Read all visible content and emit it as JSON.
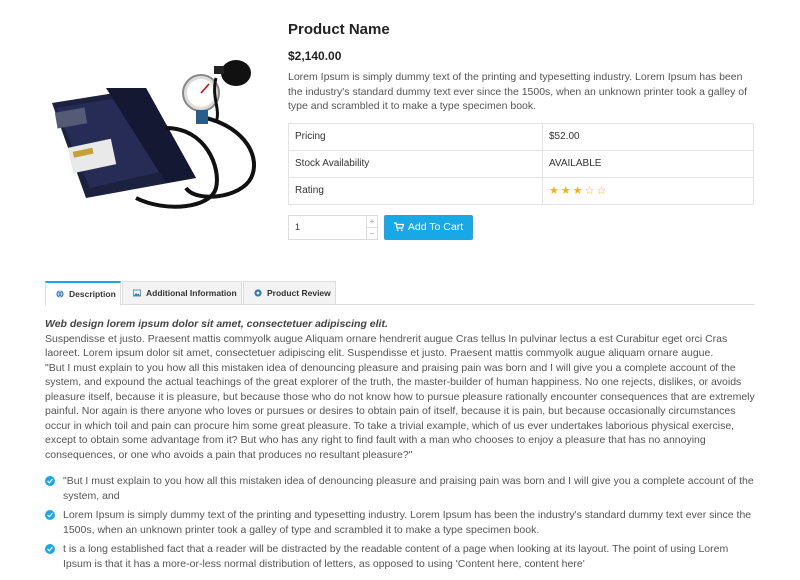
{
  "product": {
    "name": "Product Name",
    "price": "$2,140.00",
    "description": "Lorem Ipsum is simply dummy text of the printing and typesetting industry. Lorem Ipsum has been the industry's standard dummy text ever since the 1500s, when an unknown printer took a galley of type and scrambled it to make a type specimen book.",
    "image_icon": "blood-pressure-monitor"
  },
  "specs": [
    {
      "label": "Pricing",
      "value": "$52.00"
    },
    {
      "label": "Stock Availability",
      "value": "AVAILABLE"
    },
    {
      "label": "Rating",
      "rating": 3,
      "max": 5
    }
  ],
  "cart": {
    "quantity": "1",
    "add_label": "Add To Cart",
    "accent": "#19a8e6"
  },
  "tabs": [
    {
      "label": "Description",
      "icon": "globe-icon",
      "active": true
    },
    {
      "label": "Additional Information",
      "icon": "image-icon",
      "active": false
    },
    {
      "label": "Product Review",
      "icon": "circle-icon",
      "active": false
    }
  ],
  "content": {
    "lead": "Web design lorem ipsum dolor sit amet, consectetuer adipiscing elit.",
    "intro": "Suspendisse et justo. Praesent mattis commyolk augue Aliquam ornare hendrerit augue Cras tellus In pulvinar lectus a est Curabitur eget orci Cras laoreet. Lorem ipsum dolor sit amet, consectetuer adipiscing elit. Suspendisse et justo. Praesent mattis commyolk augue aliquam ornare augue.",
    "quote": "\"But I must explain to you how all this mistaken idea of denouncing pleasure and praising pain was born and I will give you a complete account of the system, and expound the actual teachings of the great explorer of the truth, the master-builder of human happiness. No one rejects, dislikes, or avoids pleasure itself, because it is pleasure, but because those who do not know how to pursue pleasure rationally encounter consequences that are extremely painful. Nor again is there anyone who loves or pursues or desires to obtain pain of itself, because it is pain, but because occasionally circumstances occur in which toil and pain can procure him some great pleasure. To take a trivial example, which of us ever undertakes laborious physical exercise, except to obtain some advantage from it? But who has any right to find fault with a man who chooses to enjoy a pleasure that has no annoying consequences, or one who avoids a pain that produces no resultant pleasure?\"",
    "bullets": [
      "\"But I must explain to you how all this mistaken idea of denouncing pleasure and praising pain was born and I will give you a complete account of the system, and",
      "Lorem Ipsum is simply dummy text of the printing and typesetting industry. Lorem Ipsum has been the industry's standard dummy text ever since the 1500s, when an unknown printer took a galley of type and scrambled it to make a type specimen book.",
      "t is a long established fact that a reader will be distracted by the readable content of a page when looking at its layout. The point of using Lorem Ipsum is that it has a more-or-less normal distribution of letters, as opposed to using 'Content here, content here'"
    ]
  }
}
